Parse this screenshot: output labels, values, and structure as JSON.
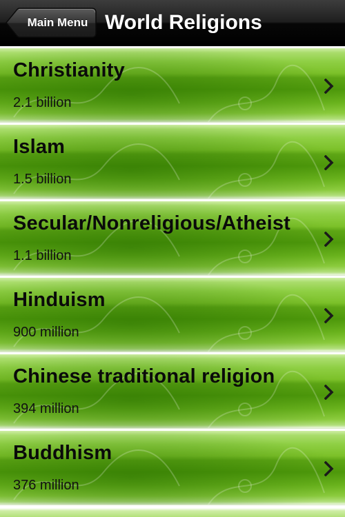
{
  "navbar": {
    "back_label": "Main Menu",
    "title": "World Religions"
  },
  "colors": {
    "navbar": "#1a1a1a",
    "row_green": "#6cb51e",
    "row_green_dark": "#4f9a0b",
    "text": "#0a0a0a"
  },
  "icons": {
    "back": "back-arrow-shape",
    "disclosure": "chevron-right-icon"
  },
  "religions": [
    {
      "name": "Christianity",
      "followers": "2.1 billion"
    },
    {
      "name": "Islam",
      "followers": "1.5 billion"
    },
    {
      "name": "Secular/Nonreligious/Atheist",
      "followers": "1.1 billion"
    },
    {
      "name": "Hinduism",
      "followers": "900 million"
    },
    {
      "name": "Chinese traditional religion",
      "followers": "394 million"
    },
    {
      "name": "Buddhism",
      "followers": "376 million"
    }
  ]
}
